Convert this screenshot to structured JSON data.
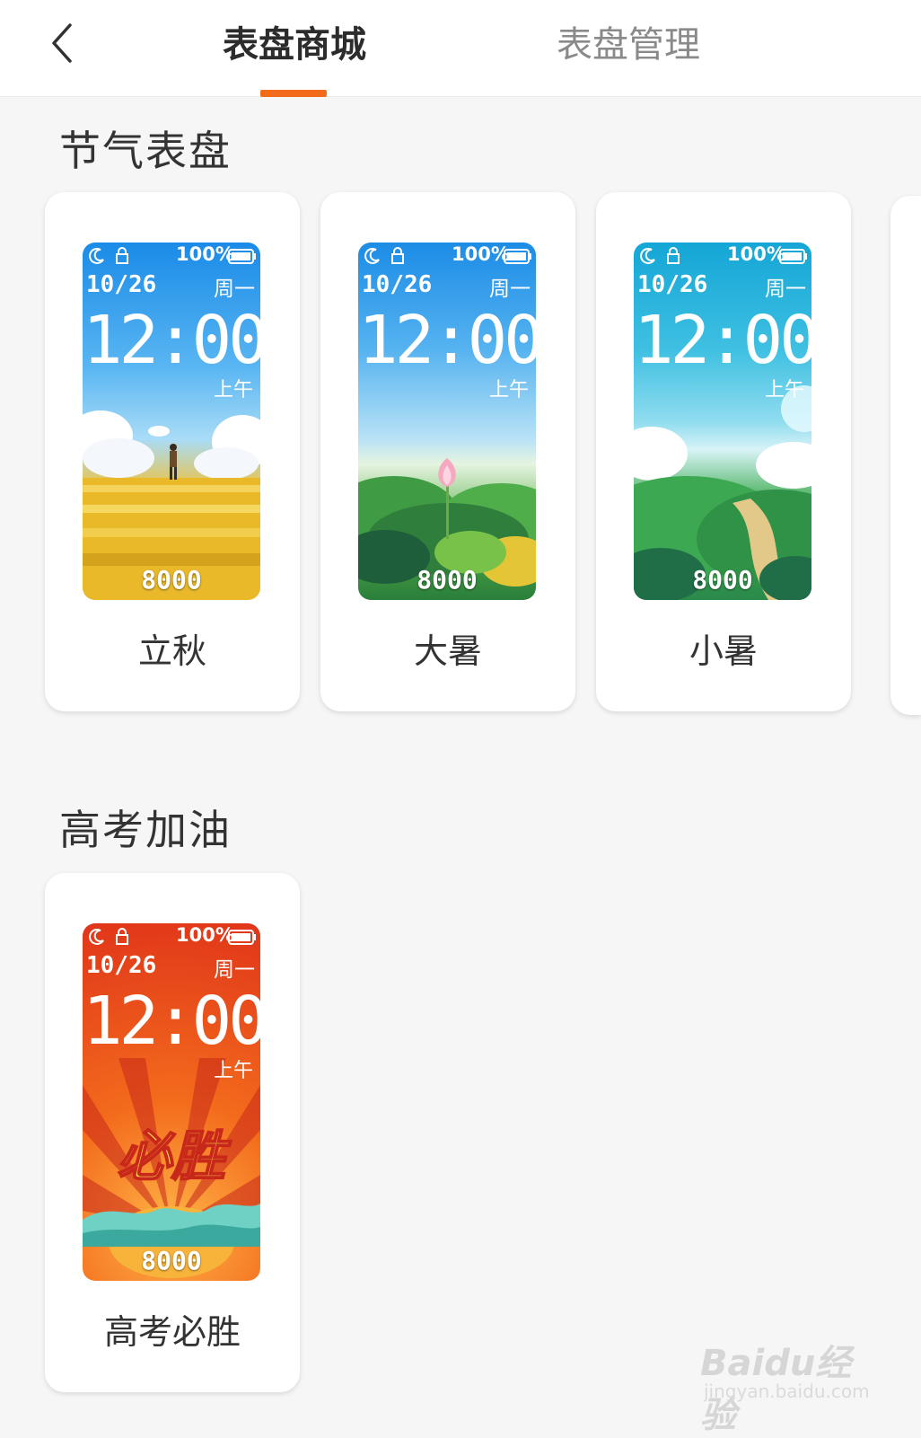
{
  "header": {
    "tabs": [
      {
        "label": "表盘商城",
        "active": true
      },
      {
        "label": "表盘管理",
        "active": false
      }
    ],
    "accent": "#f26a1b"
  },
  "sections": [
    {
      "title": "节气表盘",
      "items": [
        {
          "label": "立秋",
          "theme": "wheat-field"
        },
        {
          "label": "大暑",
          "theme": "lotus"
        },
        {
          "label": "小暑",
          "theme": "green-hills"
        }
      ]
    },
    {
      "title": "高考加油",
      "items": [
        {
          "label": "高考必胜",
          "theme": "red-rays",
          "art_text": "必胜"
        }
      ]
    }
  ],
  "watch_face": {
    "battery": "100%",
    "date": "10/26",
    "weekday": "周一",
    "time": "12:00",
    "ampm": "上午",
    "steps": "8000"
  },
  "watermark": {
    "logo": "Baidu经验",
    "url": "jingyan.baidu.com"
  }
}
